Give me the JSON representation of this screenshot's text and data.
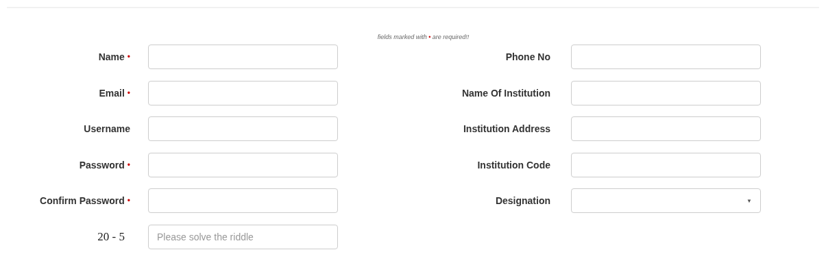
{
  "note": {
    "before": "fields marked with",
    "mark": "•",
    "after": "are required!!"
  },
  "left_fields": [
    {
      "label": "Name",
      "required": true,
      "required_mark": "•",
      "kind": "text"
    },
    {
      "label": "Email",
      "required": true,
      "required_mark": "•",
      "kind": "text"
    },
    {
      "label": "Username",
      "required": false,
      "kind": "text"
    },
    {
      "label": "Password",
      "required": true,
      "required_mark": "•",
      "kind": "text"
    },
    {
      "label": "Confirm Password",
      "required": true,
      "required_mark": "•",
      "kind": "text"
    },
    {
      "label": "20 - 5",
      "required": false,
      "kind": "riddle",
      "placeholder": "Please solve the riddle"
    }
  ],
  "right_fields": [
    {
      "label": "Phone No",
      "required": false,
      "kind": "text"
    },
    {
      "label": "Name Of Institution",
      "required": false,
      "kind": "text"
    },
    {
      "label": "Institution Address",
      "required": false,
      "kind": "text"
    },
    {
      "label": "Institution Code",
      "required": false,
      "kind": "text"
    },
    {
      "label": "Designation",
      "required": false,
      "kind": "select",
      "caret": "▼"
    }
  ]
}
